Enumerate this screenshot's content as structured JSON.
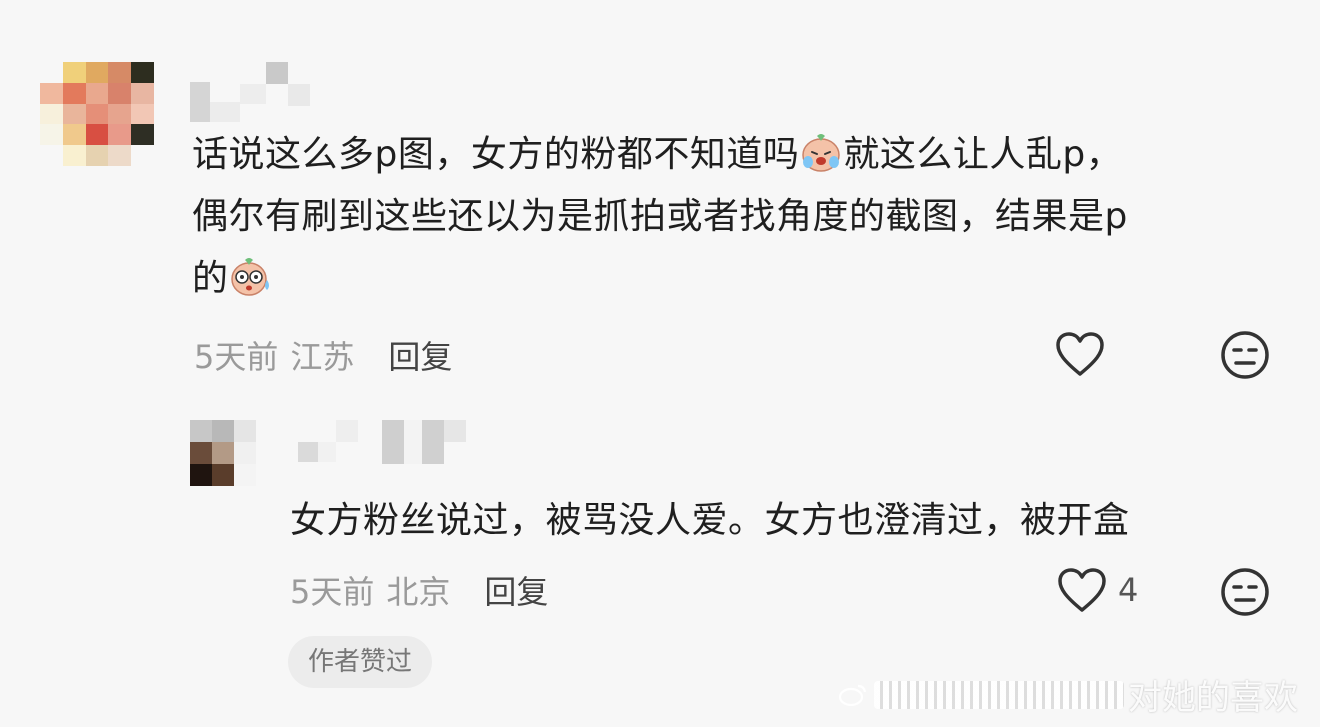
{
  "comments": [
    {
      "text_line1": "话说这么多p图，女方的粉都不知道吗",
      "text_line1b": "就这么让人乱p，",
      "text_line2": "偶尔有刷到这些还以为是抓拍或者找角度的截图，结果是p",
      "text_line3": "的",
      "time": "5天前",
      "location": "江苏",
      "reply_label": "回复",
      "emoji1": "crying-emoji",
      "emoji2": "shocked-sweat-emoji",
      "like_icon": "heart-outline-icon",
      "dislike_icon": "neutral-face-icon"
    },
    {
      "text": "女方粉丝说过，被骂没人爱。女方也澄清过，被开盒",
      "time": "5天前",
      "location": "北京",
      "reply_label": "回复",
      "like_count": "4",
      "badge": "作者赞过",
      "like_icon": "heart-outline-icon",
      "dislike_icon": "neutral-face-icon"
    }
  ],
  "watermark": {
    "text": "对她的喜欢"
  },
  "colors": {
    "background": "#f7f7f7",
    "meta": "#9a9a9a",
    "text": "#1f1f1f"
  }
}
